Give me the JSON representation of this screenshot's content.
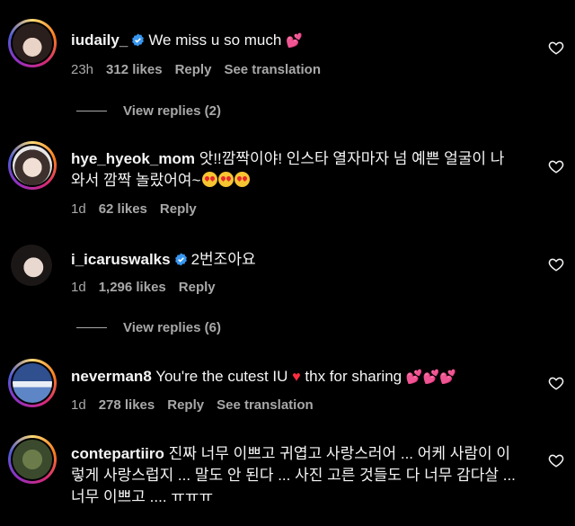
{
  "colors": {
    "background": "#000000",
    "text": "#f5f5f5",
    "muted": "#a8a8a8",
    "verified": "#3897f0"
  },
  "comments": [
    {
      "username": "iudaily_",
      "verified": true,
      "text": "We miss u so much",
      "emoji": "💕",
      "time": "23h",
      "likes": "312 likes",
      "reply": "Reply",
      "translation": "See translation",
      "view_replies": "View replies (2)"
    },
    {
      "username": "hye_hyeok_mom",
      "verified": false,
      "text_line1": "앗!!깜짝이야! 인스타 열자마자 넘 예쁜 얼굴이 나",
      "text_line2": "와서 깜짝 놀랐어여~",
      "time": "1d",
      "likes": "62 likes",
      "reply": "Reply"
    },
    {
      "username": "i_icaruswalks",
      "verified": true,
      "text": "2번조아요",
      "time": "1d",
      "likes": "1,296 likes",
      "reply": "Reply",
      "view_replies": "View replies (6)"
    },
    {
      "username": "neverman8",
      "verified": false,
      "text_a": "You're the cutest IU",
      "text_b": "thx for sharing",
      "time": "1d",
      "likes": "278 likes",
      "reply": "Reply",
      "translation": "See translation"
    },
    {
      "username": "contepartiiro",
      "verified": false,
      "text_line1": "진짜 너무 이쁘고 귀엽고 사랑스러어 ... 어케 사람이 이",
      "text_line2": "렇게 사랑스럽지 ... 말도 안 된다 ... 사진 고른 것들도 다 너무 감다살 ...",
      "text_line3": "너무 이쁘고 .... ㅠㅠㅠ"
    }
  ],
  "icons": [
    "verified-badge-icon",
    "heart-outline-icon"
  ]
}
